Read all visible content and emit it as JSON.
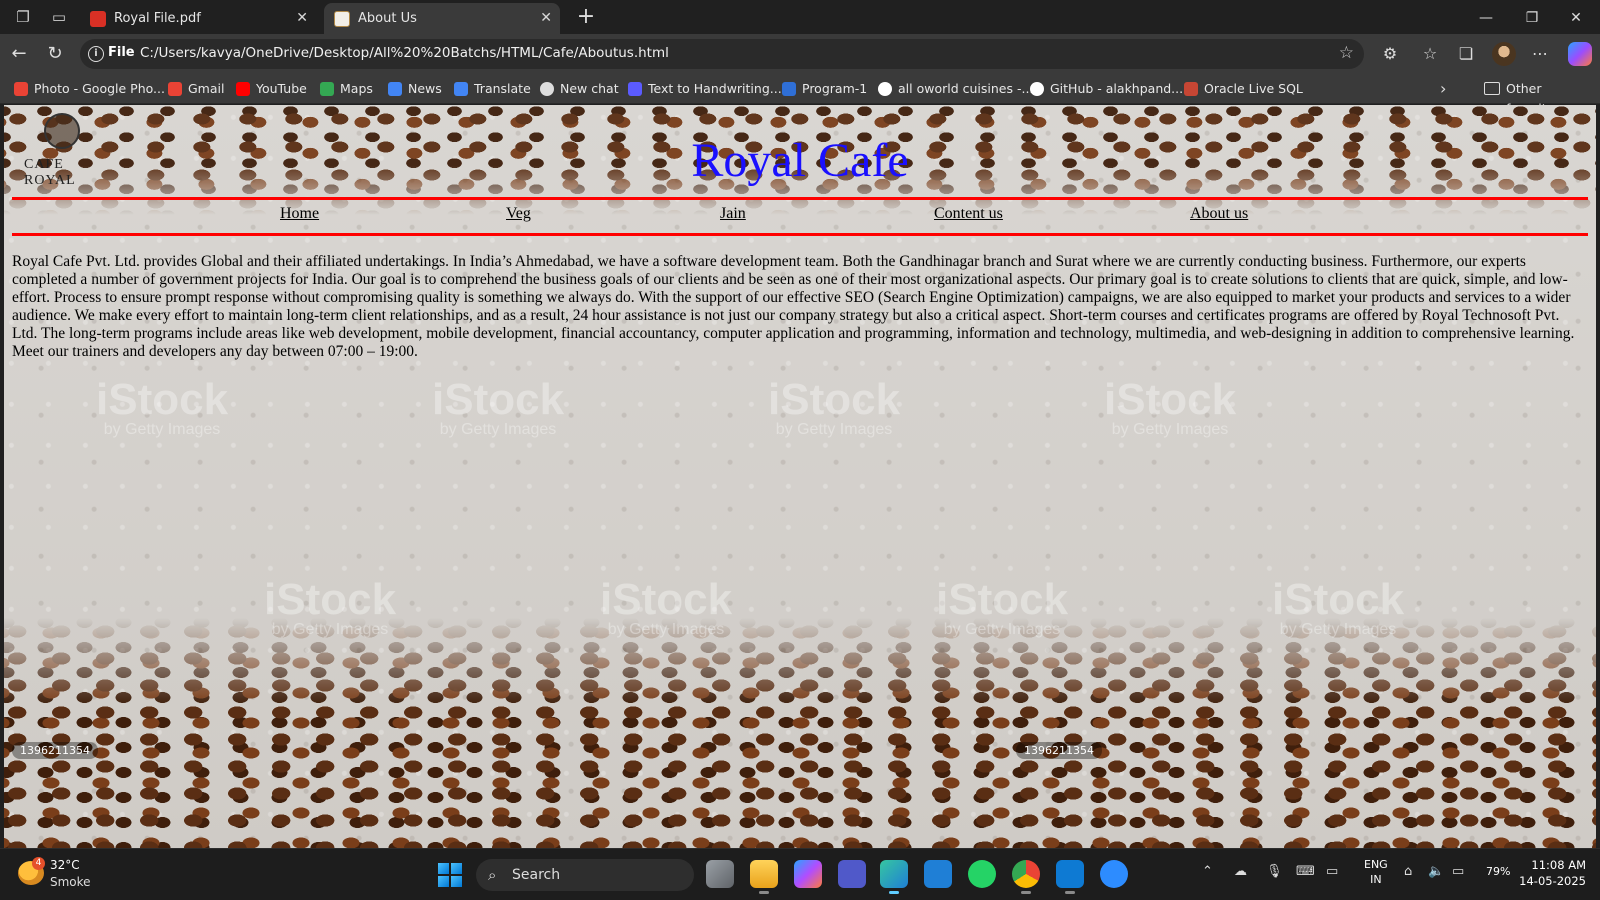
{
  "browser": {
    "tabs": [
      {
        "title": "Royal File.pdf",
        "active": false
      },
      {
        "title": "About Us",
        "active": true
      }
    ],
    "address": {
      "scheme": "File",
      "url": "C:/Users/kavya/OneDrive/Desktop/All%20%20Batchs/HTML/Cafe/Aboutus.html"
    },
    "bookmarks": [
      {
        "label": "Photo - Google Pho...",
        "color": "#ea4335"
      },
      {
        "label": "Gmail",
        "color": "#ea4335"
      },
      {
        "label": "YouTube",
        "color": "#ff0000"
      },
      {
        "label": "Maps",
        "color": "#34a853"
      },
      {
        "label": "News",
        "color": "#4285f4"
      },
      {
        "label": "Translate",
        "color": "#4285f4"
      },
      {
        "label": "New chat",
        "color": "#dddddd"
      },
      {
        "label": "Text to Handwriting...",
        "color": "#5b5bff"
      },
      {
        "label": "Program-1",
        "color": "#2f6fd6"
      },
      {
        "label": "all oworld cuisines -...",
        "color": "#ffffff"
      },
      {
        "label": "GitHub - alakhpand...",
        "color": "#ffffff"
      },
      {
        "label": "Oracle Live SQL",
        "color": "#c74634"
      }
    ],
    "other_favorites": "Other favorites"
  },
  "page": {
    "logo_text": "CAFE ROYAL",
    "title": "Royal Cafe",
    "title_color": "#1a10ff",
    "rule_color": "#ff0000",
    "menu": [
      "Home",
      "Veg",
      "Jain",
      "Content us",
      "About us"
    ],
    "about": "Royal Cafe Pvt. Ltd. provides Global and their affiliated undertakings. In India’s Ahmedabad, we have a software development team. Both the Gandhinagar branch and Surat where we are currently conducting business. Furthermore, our experts completed a number of government projects for India. Our goal is to comprehend the business goals of our clients and be seen as one of their most organizational aspects. Our primary goal is to create solutions to clients that are quick, simple, and low-effort. Process to ensure prompt response without compromising quality is something we always do. With the support of our effective SEO (Search Engine Optimization) campaigns, we are also equipped to market your products and services to a wider audience. We make every effort to maintain long-term client relationships, and as a result, 24 hour assistance is not just our company strategy but also a critical aspect. Short-term courses and certificates programs are offered by Royal Technosoft Pvt. Ltd. The long-term programs include areas like web development, mobile development, financial accountancy, computer application and programming, information and technology, multimedia, and web-designing in addition to comprehensive learning. Meet our trainers and developers any day between 07:00 – 19:00.",
    "watermark": {
      "brand": "iStock",
      "sub": "by Getty Images"
    },
    "stock_id": "1396211354"
  },
  "taskbar": {
    "weather": {
      "temp": "32°C",
      "condition": "Smoke",
      "badge": "4"
    },
    "search_label": "Search",
    "lang": {
      "line1": "ENG",
      "line2": "IN"
    },
    "battery": "79%",
    "time": "11:08 AM",
    "date": "14-05-2025"
  }
}
